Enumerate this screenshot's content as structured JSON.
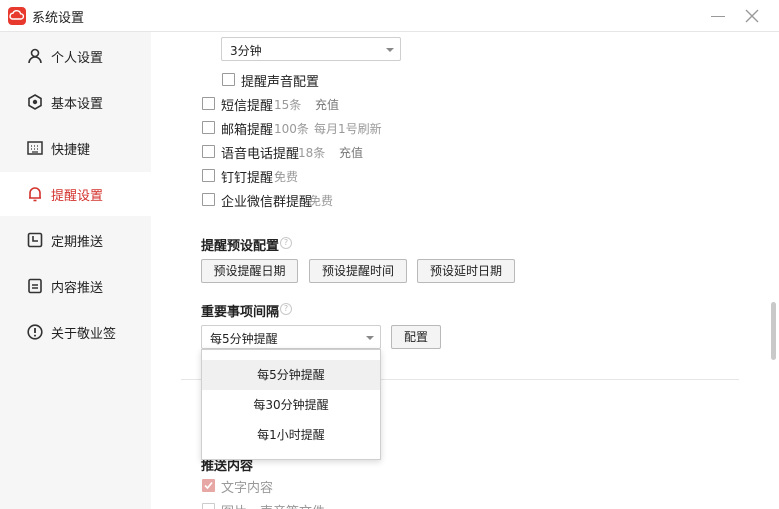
{
  "window": {
    "title": "系统设置"
  },
  "sidebar": {
    "items": [
      {
        "label": "个人设置",
        "icon": "person-icon"
      },
      {
        "label": "基本设置",
        "icon": "gear-icon"
      },
      {
        "label": "快捷键",
        "icon": "keyboard-icon"
      },
      {
        "label": "提醒设置",
        "icon": "bell-icon",
        "active": true
      },
      {
        "label": "定期推送",
        "icon": "calendar-clock-icon"
      },
      {
        "label": "内容推送",
        "icon": "document-icon"
      },
      {
        "label": "关于敬业签",
        "icon": "info-icon"
      }
    ]
  },
  "reminder": {
    "interval_select": "3分钟",
    "sound_config": "提醒声音配置",
    "channels": [
      {
        "label": "短信提醒",
        "count": "15条",
        "action": "充值"
      },
      {
        "label": "邮箱提醒",
        "count": "100条",
        "action": "每月1号刷新"
      },
      {
        "label": "语音电话提醒",
        "count": "18条",
        "action": "充值"
      },
      {
        "label": "钉钉提醒",
        "count": "免费",
        "action": ""
      },
      {
        "label": "企业微信群提醒",
        "count": "免费",
        "action": ""
      }
    ]
  },
  "presets": {
    "title": "提醒预设配置",
    "buttons": [
      "预设提醒日期",
      "预设提醒时间",
      "预设延时日期"
    ]
  },
  "important": {
    "title": "重要事项间隔",
    "selected": "每5分钟提醒",
    "config_button": "配置",
    "options": [
      "每5分钟提醒",
      "每30分钟提醒",
      "每1小时提醒"
    ]
  },
  "push": {
    "title": "推送内容",
    "items": [
      {
        "label": "文字内容",
        "checked": true
      },
      {
        "label": "图片、声音等文件",
        "checked": false
      }
    ]
  },
  "colors": {
    "accent": "#d3322d",
    "logo": "#e8392f"
  }
}
